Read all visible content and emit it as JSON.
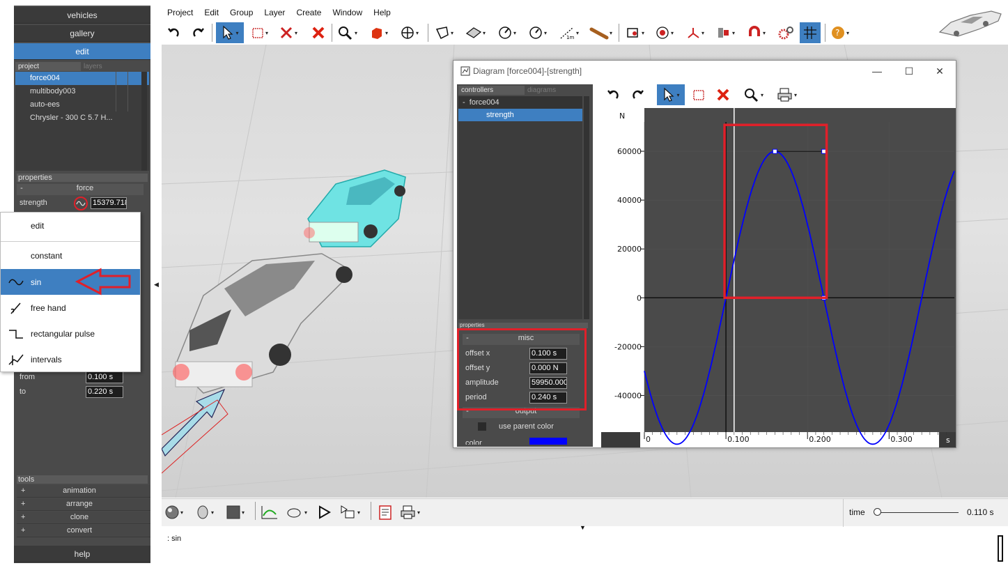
{
  "left_panel": {
    "buttons": {
      "vehicles": "vehicles",
      "gallery": "gallery",
      "edit": "edit",
      "help": "help"
    },
    "project_tabs": {
      "project": "project",
      "layers": "layers"
    },
    "project_items": [
      "force004",
      "multibody003",
      "auto-ees",
      "Chrysler - 300 C 5.7 H..."
    ],
    "properties_header": "properties",
    "force_group": "force",
    "strength_label": "strength",
    "strength_value": "15379.718",
    "from_label": "from",
    "from_value": "0.100 s",
    "to_label": "to",
    "to_value": "0.220 s",
    "tools_header": "tools",
    "tools": [
      "animation",
      "arrange",
      "clone",
      "convert"
    ]
  },
  "popup_menu": {
    "items": [
      "edit",
      "constant",
      "sin",
      "free hand",
      "rectangular pulse",
      "intervals"
    ],
    "selected": "sin"
  },
  "menubar": [
    "Project",
    "Edit",
    "Group",
    "Layer",
    "Create",
    "Window",
    "Help"
  ],
  "diagram": {
    "title": "Diagram [force004]-[strength]",
    "tabs": {
      "controllers": "controllers",
      "diagrams": "diagrams"
    },
    "tree": {
      "parent": "force004",
      "child": "strength"
    },
    "properties_header": "properties",
    "misc_group": "misc",
    "misc": [
      {
        "label": "offset x",
        "value": "0.100 s"
      },
      {
        "label": "offset y",
        "value": "0.000 N"
      },
      {
        "label": "amplitude",
        "value": "59950.000"
      },
      {
        "label": "period",
        "value": "0.240 s"
      }
    ],
    "output_group": "output",
    "use_parent_color": "use parent color",
    "color_label": "color",
    "color_value": "#0000ff"
  },
  "chart_data": {
    "type": "line",
    "function": "sin",
    "series": [
      {
        "offset_x": 0.1,
        "offset_y": 0.0,
        "amplitude": 59950,
        "period": 0.24
      }
    ],
    "xlabel": "s",
    "ylabel": "N",
    "x_ticks": [
      "0",
      "0.100",
      "0.200",
      "0.300"
    ],
    "y_ticks": [
      "60000",
      "40000",
      "20000",
      "0",
      "-20000",
      "-40000"
    ],
    "xlim": [
      0,
      0.38
    ],
    "ylim": [
      -55000,
      72000
    ],
    "line_color": "#0000ff"
  },
  "bottom": {
    "time_label": "time",
    "time_value": "0.110 s",
    "status": ": sin"
  }
}
